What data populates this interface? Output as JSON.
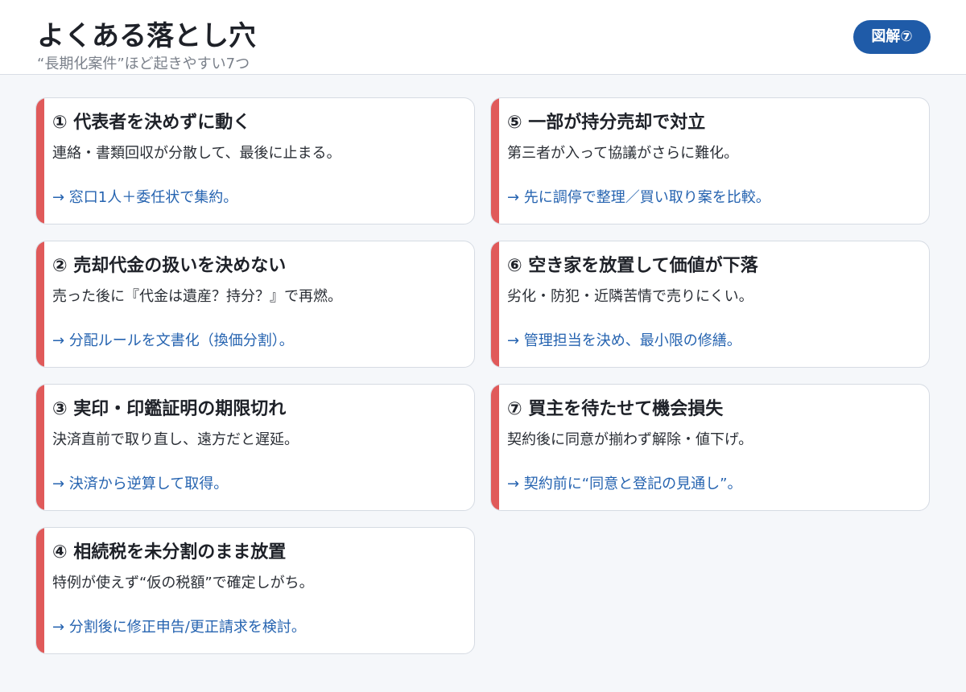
{
  "header": {
    "title": "よくある落とし穴",
    "subtitle": "“長期化案件”ほど起きやすい7つ",
    "badge": "図解⑦"
  },
  "colors": {
    "accent": "#e05a5a",
    "badge": "#1f5ba8",
    "tip": "#2563b0"
  },
  "cards": [
    {
      "title": "① 代表者を決めずに動く",
      "desc": "連絡・書類回収が分散して、最後に止まる。",
      "tip": "→ 窓口1人＋委任状で集約。"
    },
    {
      "title": "② 売却代金の扱いを決めない",
      "desc": "売った後に『代金は遺産？持分？』で再燃。",
      "tip": "→ 分配ルールを文書化（換価分割）。"
    },
    {
      "title": "③ 実印・印鑑証明の期限切れ",
      "desc": "決済直前で取り直し、遠方だと遅延。",
      "tip": "→ 決済から逆算して取得。"
    },
    {
      "title": "④ 相続税を未分割のまま放置",
      "desc": "特例が使えず“仮の税額”で確定しがち。",
      "tip": "→ 分割後に修正申告/更正請求を検討。"
    },
    {
      "title": "⑤ 一部が持分売却で対立",
      "desc": "第三者が入って協議がさらに難化。",
      "tip": "→ 先に調停で整理／買い取り案を比較。"
    },
    {
      "title": "⑥ 空き家を放置して価値が下落",
      "desc": "劣化・防犯・近隣苦情で売りにくい。",
      "tip": "→ 管理担当を決め、最小限の修繕。"
    },
    {
      "title": "⑦ 買主を待たせて機会損失",
      "desc": "契約後に同意が揃わず解除・値下げ。",
      "tip": "→ 契約前に“同意と登記の見通し”。"
    }
  ]
}
